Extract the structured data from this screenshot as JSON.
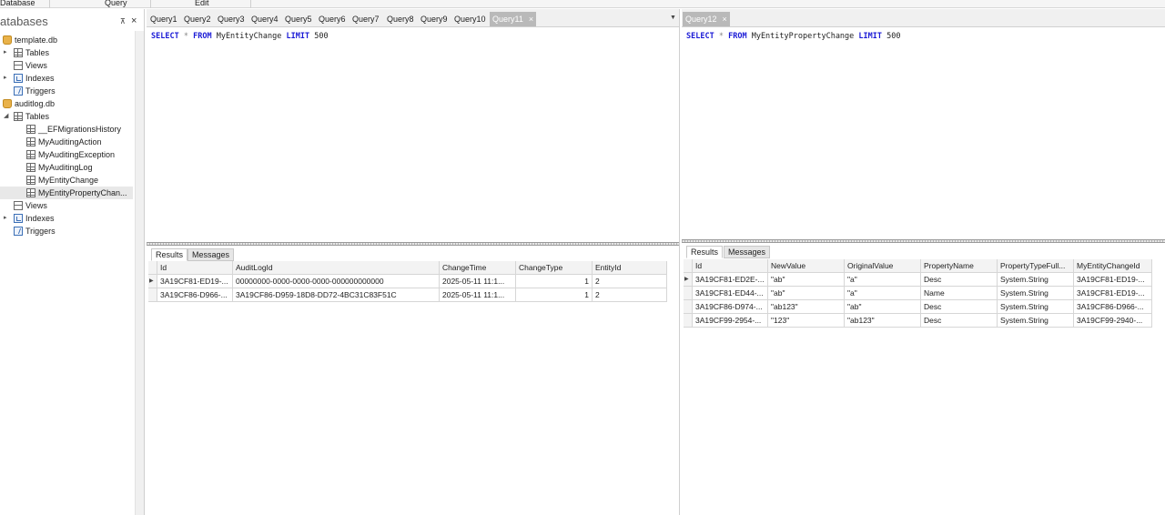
{
  "menu": {
    "database": "Database",
    "query": "Query",
    "edit": "Edit"
  },
  "sidebar": {
    "title": "atabases",
    "pin": "⊼",
    "close": "×",
    "tree": [
      {
        "label": "template.db",
        "icon": "database-icon",
        "expander": "",
        "indent": 0
      },
      {
        "label": "Tables",
        "icon": "table-icon",
        "expander": "▸",
        "indent": 1
      },
      {
        "label": "Views",
        "icon": "view-icon",
        "expander": "",
        "indent": 1
      },
      {
        "label": "Indexes",
        "icon": "index-icon",
        "expander": "▸",
        "indent": 1
      },
      {
        "label": "Triggers",
        "icon": "trigger-icon",
        "expander": "",
        "indent": 1
      },
      {
        "label": "auditlog.db",
        "icon": "database-icon",
        "expander": "",
        "indent": 0
      },
      {
        "label": "Tables",
        "icon": "table-icon",
        "expander": "◢",
        "indent": 1
      },
      {
        "label": "__EFMigrationsHistory",
        "icon": "table-icon",
        "expander": "",
        "indent": 2
      },
      {
        "label": "MyAuditingAction",
        "icon": "table-icon",
        "expander": "",
        "indent": 2
      },
      {
        "label": "MyAuditingException",
        "icon": "table-icon",
        "expander": "",
        "indent": 2
      },
      {
        "label": "MyAuditingLog",
        "icon": "table-icon",
        "expander": "",
        "indent": 2
      },
      {
        "label": "MyEntityChange",
        "icon": "table-icon",
        "expander": "",
        "indent": 2
      },
      {
        "label": "MyEntityPropertyChan...",
        "icon": "table-icon",
        "expander": "",
        "indent": 2,
        "selected": true
      },
      {
        "label": "Views",
        "icon": "view-icon",
        "expander": "",
        "indent": 1
      },
      {
        "label": "Indexes",
        "icon": "index-icon",
        "expander": "▸",
        "indent": 1
      },
      {
        "label": "Triggers",
        "icon": "trigger-icon",
        "expander": "",
        "indent": 1
      }
    ]
  },
  "left_pane": {
    "tabs": [
      "Query1",
      "Query2",
      "Query3",
      "Query4",
      "Query5",
      "Query6",
      "Query7",
      "Query8",
      "Query9",
      "Query10",
      "Query11"
    ],
    "active_tab": "Query11",
    "tab_close": "×",
    "dropdown": "▼",
    "sql": {
      "kw1": "SELECT",
      "star": "*",
      "kw2": "FROM",
      "table": "MyEntityChange",
      "kw3": "LIMIT",
      "limit": "500"
    },
    "result_tabs": {
      "results": "Results",
      "messages": "Messages"
    },
    "grid": {
      "columns": [
        "Id",
        "AuditLogId",
        "ChangeTime",
        "ChangeType",
        "EntityId"
      ],
      "rows": [
        [
          "3A19CF81-ED19-...",
          "00000000-0000-0000-0000-000000000000",
          "2025-05-11 11:1...",
          "1",
          "2"
        ],
        [
          "3A19CF86-D966-...",
          "3A19CF86-D959-18D8-DD72-4BC31C83F51C",
          "2025-05-11 11:1...",
          "1",
          "2"
        ]
      ],
      "row_marker": "▶"
    }
  },
  "right_pane": {
    "tab": "Query12",
    "tab_close": "×",
    "sql": {
      "kw1": "SELECT",
      "star": "*",
      "kw2": "FROM",
      "table": "MyEntityPropertyChange",
      "kw3": "LIMIT",
      "limit": "500"
    },
    "result_tabs": {
      "results": "Results",
      "messages": "Messages"
    },
    "grid": {
      "columns": [
        "Id",
        "NewValue",
        "OriginalValue",
        "PropertyName",
        "PropertyTypeFull...",
        "MyEntityChangeId"
      ],
      "rows": [
        [
          "3A19CF81-ED2E-...",
          "\"ab\"",
          "\"a\"",
          "Desc",
          "System.String",
          "3A19CF81-ED19-..."
        ],
        [
          "3A19CF81-ED44-...",
          "\"ab\"",
          "\"a\"",
          "Name",
          "System.String",
          "3A19CF81-ED19-..."
        ],
        [
          "3A19CF86-D974-...",
          "\"ab123\"",
          "\"ab\"",
          "Desc",
          "System.String",
          "3A19CF86-D966-..."
        ],
        [
          "3A19CF99-2954-...",
          "\"123\"",
          "\"ab123\"",
          "Desc",
          "System.String",
          "3A19CF99-2940-..."
        ]
      ],
      "row_marker": "▶"
    }
  }
}
